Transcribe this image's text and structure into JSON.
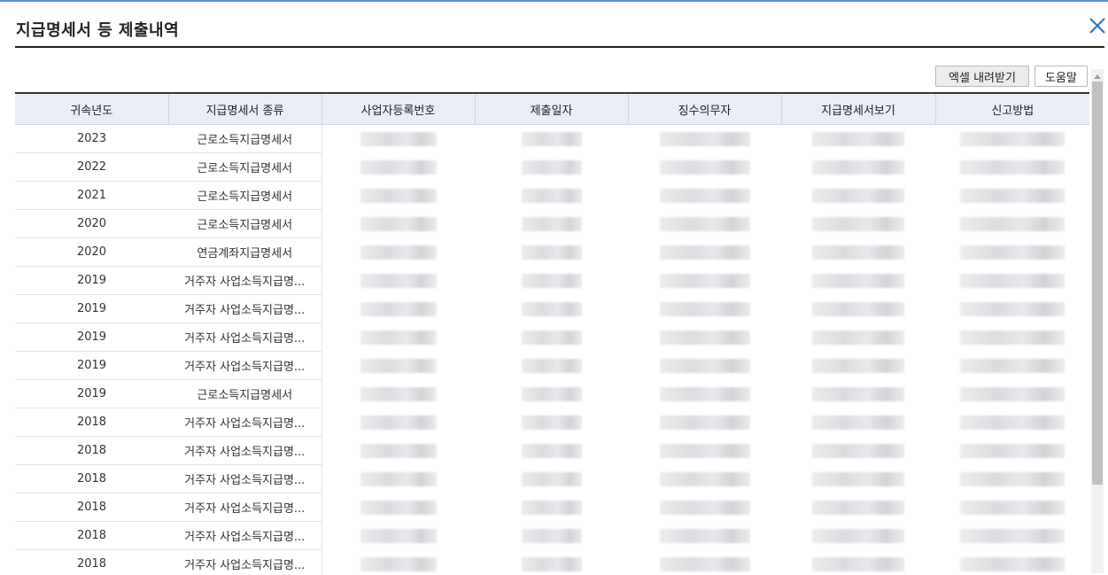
{
  "dialog": {
    "title": "지급명세서 등 제출내역",
    "close_icon": "close-icon"
  },
  "toolbar": {
    "excel_label": "엑셀 내려받기",
    "help_label": "도움말"
  },
  "table": {
    "columns": [
      "귀속년도",
      "지급명세서 종류",
      "사업자등록번호",
      "제출일자",
      "징수의무자",
      "지급명세서보기",
      "신고방법"
    ],
    "rows": [
      {
        "year": "2023",
        "type": "근로소득지급명세서"
      },
      {
        "year": "2022",
        "type": "근로소득지급명세서"
      },
      {
        "year": "2021",
        "type": "근로소득지급명세서"
      },
      {
        "year": "2020",
        "type": "근로소득지급명세서"
      },
      {
        "year": "2020",
        "type": "연금계좌지급명세서"
      },
      {
        "year": "2019",
        "type": "거주자 사업소득지급명..."
      },
      {
        "year": "2019",
        "type": "거주자 사업소득지급명..."
      },
      {
        "year": "2019",
        "type": "거주자 사업소득지급명..."
      },
      {
        "year": "2019",
        "type": "거주자 사업소득지급명..."
      },
      {
        "year": "2019",
        "type": "근로소득지급명세서"
      },
      {
        "year": "2018",
        "type": "거주자 사업소득지급명..."
      },
      {
        "year": "2018",
        "type": "거주자 사업소득지급명..."
      },
      {
        "year": "2018",
        "type": "거주자 사업소득지급명..."
      },
      {
        "year": "2018",
        "type": "거주자 사업소득지급명..."
      },
      {
        "year": "2018",
        "type": "거주자 사업소득지급명..."
      },
      {
        "year": "2018",
        "type": "거주자 사업소득지급명..."
      }
    ]
  }
}
